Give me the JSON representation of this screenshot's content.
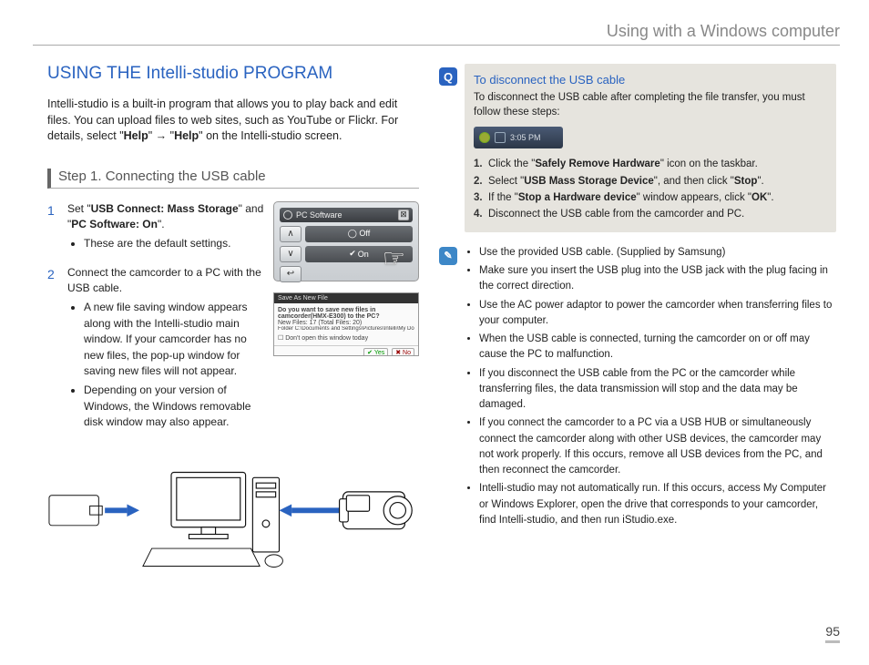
{
  "header": {
    "title": "Using with a Windows computer"
  },
  "main": {
    "title": "USING THE Intelli-studio PROGRAM",
    "intro_pre": "Intelli-studio is a built-in program that allows you to play back and edit files. You can upload files to web sites, such as YouTube or Flickr. For details, select \"",
    "help1": "Help",
    "intro_mid": "\" → \"",
    "help2": "Help",
    "intro_post": "\" on the Intelli-studio screen.",
    "step1_title": "Step 1. Connecting the USB cable",
    "steps": [
      {
        "pre": "Set \"",
        "b1": "USB Connect: Mass Storage",
        "mid": "\" and \"",
        "b2": "PC Software: On",
        "post": "\".",
        "sub": [
          "These are the default settings."
        ]
      },
      {
        "text": "Connect the camcorder to a PC with the USB cable.",
        "sub": [
          "A new file saving window appears along with the Intelli-studio main window. If your camcorder has no new files, the pop-up window for saving new files will not appear.",
          "Depending on your version of Windows, the Windows removable disk window may also appear."
        ]
      }
    ],
    "thumb1": {
      "label": "PC Software",
      "on": "On"
    },
    "thumb2": {
      "title": "Save As New File",
      "line1": "Do you want to save new files in camcorder(HMX-E300) to the PC?",
      "line2": "New Files: 17 (Total Files: 20)",
      "line3": "Folder    C:\\Documents and Settings\\Pictures\\Intelli\\My Documents\\IM Intelli    Change",
      "check": "Don't open this window today",
      "yes": "Yes",
      "no": "No"
    }
  },
  "right": {
    "disconnect": {
      "title": "To disconnect the USB cable",
      "desc": "To disconnect the USB cable after completing the file transfer, you must follow these steps:",
      "time": "3:05 PM",
      "steps": [
        {
          "pre": "Click the \"",
          "b": "Safely Remove Hardware",
          "post": "\" icon on the taskbar."
        },
        {
          "pre": "Select \"",
          "b": "USB Mass Storage Device",
          "post": "\", and then click \"",
          "b2": "Stop",
          "post2": "\"."
        },
        {
          "pre": "If the \"",
          "b": "Stop a Hardware device",
          "post": "\" window appears, click \"",
          "b2": "OK",
          "post2": "\"."
        },
        {
          "pre": "Disconnect the USB cable from the camcorder and PC."
        }
      ]
    },
    "notes": [
      "Use the provided USB cable. (Supplied by Samsung)",
      "Make sure you insert the USB plug into the USB jack with the plug facing in the correct direction.",
      "Use the AC power adaptor to power the camcorder when transferring files to your computer.",
      "When the USB cable is connected, turning the camcorder on or off may cause the PC to malfunction.",
      "If you disconnect the USB cable from the PC or the camcorder while transferring files, the data transmission will stop and the data may be damaged.",
      "If you connect the camcorder to a PC via a USB HUB or simultaneously connect the camcorder along with other USB devices, the camcorder may not work properly. If this occurs, remove all USB devices from the PC, and then reconnect the camcorder.",
      "Intelli-studio may not automatically run. If this occurs, access My Computer or Windows Explorer, open the drive that corresponds to your camcorder, find Intelli-studio, and then run iStudio.exe."
    ]
  },
  "page_number": "95"
}
